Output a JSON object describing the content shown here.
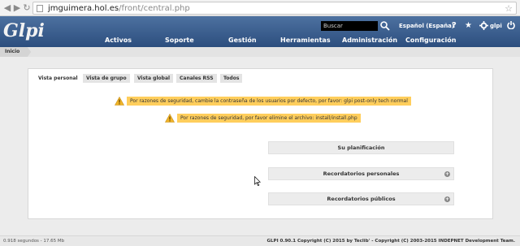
{
  "browser": {
    "url_host": "jmguimera.hol.es",
    "url_path": "/front/central.php",
    "back_icon": "back-icon",
    "forward_icon": "forward-icon",
    "reload_icon": "reload-icon"
  },
  "header": {
    "logo": "Glpi",
    "search_placeholder": "Buscar",
    "language": "Español (España)",
    "help": "?",
    "favorite": "★",
    "user": "glpi",
    "menu": [
      "Activos",
      "Soporte",
      "Gestión",
      "Herramientas",
      "Administración",
      "Configuración"
    ],
    "colors": {
      "bar_top": "#4d71a0",
      "bar_bottom": "#2c4e7e"
    }
  },
  "breadcrumb": {
    "home": "Inicio"
  },
  "tabs": [
    "Vista personal",
    "Vista de grupo",
    "Vista global",
    "Canales RSS",
    "Todos"
  ],
  "warnings": [
    "Por razones de seguridad, cambie la contraseña de los usuarios por defecto, por favor: glpi post-only tech normal",
    "Por razones de seguridad, por favor elimine el archivo: install/install.php"
  ],
  "boxes": {
    "planning": "Su planificación",
    "personal_reminders": "Recordatorios personales",
    "public_reminders": "Recordatorios públicos"
  },
  "footer": {
    "timing": "0.918 segundos - 17.65 Mb",
    "copyright": "GLPI 0.90.1 Copyright (C) 2015 by Teclib' - Copyright (C) 2003-2015 INDEPNET Development Team."
  },
  "colors": {
    "warning": "#ffce5c",
    "page_bg": "#ececec"
  }
}
